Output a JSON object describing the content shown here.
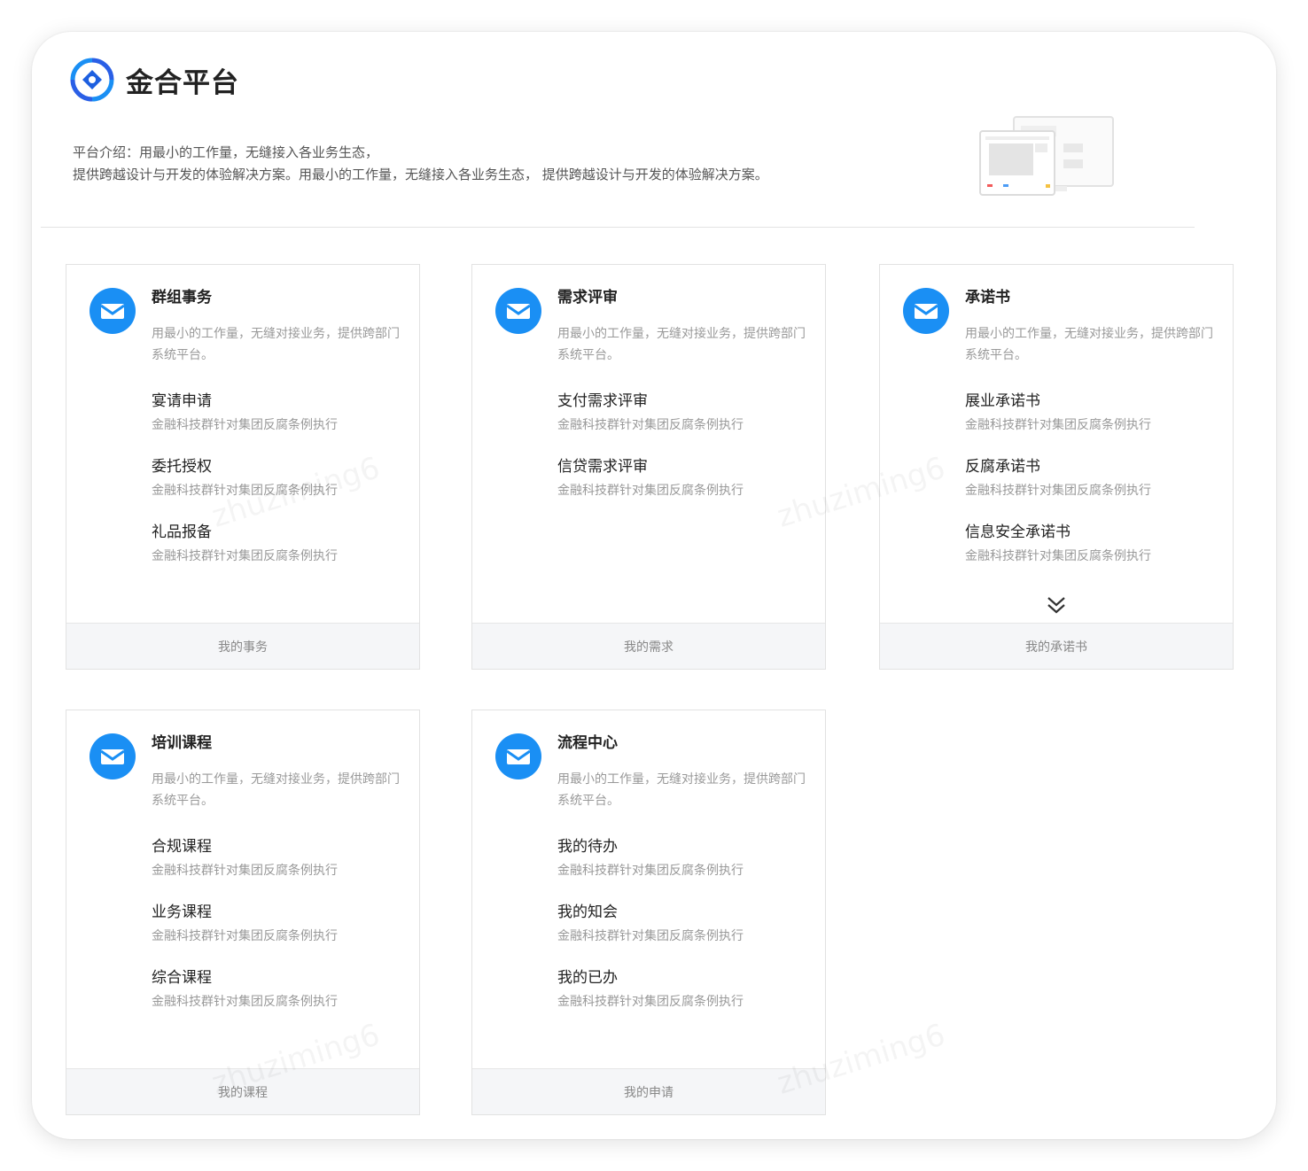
{
  "header": {
    "app_name": "金合平台",
    "intro_line1": "平台介绍：用最小的工作量，无缝接入各业务生态，",
    "intro_line2": "提供跨越设计与开发的体验解决方案。用最小的工作量，无缝接入各业务生态， 提供跨越设计与开发的体验解决方案。"
  },
  "accent_color": "#1a8ff4",
  "watermark_text": "zhuziming6",
  "cards": [
    {
      "title": "群组事务",
      "desc": "用最小的工作量，无缝对接业务，提供跨部门系统平台。",
      "items": [
        {
          "title": "宴请申请",
          "sub": "金融科技群针对集团反腐条例执行"
        },
        {
          "title": "委托授权",
          "sub": "金融科技群针对集团反腐条例执行"
        },
        {
          "title": "礼品报备",
          "sub": "金融科技群针对集团反腐条例执行"
        }
      ],
      "footer": "我的事务"
    },
    {
      "title": "需求评审",
      "desc": "用最小的工作量，无缝对接业务，提供跨部门系统平台。",
      "items": [
        {
          "title": "支付需求评审",
          "sub": "金融科技群针对集团反腐条例执行"
        },
        {
          "title": "信贷需求评审",
          "sub": "金融科技群针对集团反腐条例执行"
        }
      ],
      "footer": "我的需求"
    },
    {
      "title": "承诺书",
      "desc": "用最小的工作量，无缝对接业务，提供跨部门系统平台。",
      "items": [
        {
          "title": "展业承诺书",
          "sub": "金融科技群针对集团反腐条例执行"
        },
        {
          "title": "反腐承诺书",
          "sub": "金融科技群针对集团反腐条例执行"
        },
        {
          "title": "信息安全承诺书",
          "sub": "金融科技群针对集团反腐条例执行"
        }
      ],
      "footer": "我的承诺书",
      "more_icon": "double-chevron-down-icon"
    },
    {
      "title": "培训课程",
      "desc": "用最小的工作量，无缝对接业务，提供跨部门系统平台。",
      "items": [
        {
          "title": "合规课程",
          "sub": "金融科技群针对集团反腐条例执行"
        },
        {
          "title": "业务课程",
          "sub": "金融科技群针对集团反腐条例执行"
        },
        {
          "title": "综合课程",
          "sub": "金融科技群针对集团反腐条例执行"
        }
      ],
      "footer": "我的课程"
    },
    {
      "title": "流程中心",
      "desc": "用最小的工作量，无缝对接业务，提供跨部门系统平台。",
      "items": [
        {
          "title": "我的待办",
          "sub": "金融科技群针对集团反腐条例执行"
        },
        {
          "title": "我的知会",
          "sub": "金融科技群针对集团反腐条例执行"
        },
        {
          "title": "我的已办",
          "sub": "金融科技群针对集团反腐条例执行"
        }
      ],
      "footer": "我的申请"
    }
  ]
}
